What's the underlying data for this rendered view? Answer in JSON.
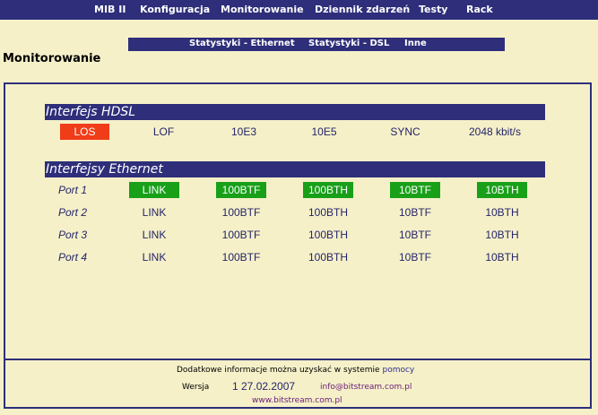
{
  "topnav": [
    "MIB II",
    "Konfiguracja",
    "Monitorowanie",
    "Dziennik zdarzeń",
    "Testy",
    "Rack"
  ],
  "subnav": [
    "Statystyki - Ethernet",
    "Statystyki - DSL",
    "Inne"
  ],
  "page_title": "Monitorowanie",
  "hdsl": {
    "title": "Interfejs HDSL",
    "cells": [
      {
        "text": "LOS",
        "state": "alarm"
      },
      {
        "text": "LOF",
        "state": "off"
      },
      {
        "text": "10E3",
        "state": "off"
      },
      {
        "text": "10E5",
        "state": "off"
      },
      {
        "text": "SYNC",
        "state": "off"
      },
      {
        "text": "2048 kbit/s",
        "state": "off"
      }
    ]
  },
  "ethernet": {
    "title": "Interfejsy Ethernet",
    "ports": [
      {
        "label": "Port 1",
        "cells": [
          {
            "text": "LINK",
            "state": "on"
          },
          {
            "text": "100BTF",
            "state": "on"
          },
          {
            "text": "100BTH",
            "state": "on"
          },
          {
            "text": "10BTF",
            "state": "on"
          },
          {
            "text": "10BTH",
            "state": "on"
          }
        ]
      },
      {
        "label": "Port 2",
        "cells": [
          {
            "text": "LINK",
            "state": "off"
          },
          {
            "text": "100BTF",
            "state": "off"
          },
          {
            "text": "100BTH",
            "state": "off"
          },
          {
            "text": "10BTF",
            "state": "off"
          },
          {
            "text": "10BTH",
            "state": "off"
          }
        ]
      },
      {
        "label": "Port 3",
        "cells": [
          {
            "text": "LINK",
            "state": "off"
          },
          {
            "text": "100BTF",
            "state": "off"
          },
          {
            "text": "100BTH",
            "state": "off"
          },
          {
            "text": "10BTF",
            "state": "off"
          },
          {
            "text": "10BTH",
            "state": "off"
          }
        ]
      },
      {
        "label": "Port 4",
        "cells": [
          {
            "text": "LINK",
            "state": "off"
          },
          {
            "text": "100BTF",
            "state": "off"
          },
          {
            "text": "100BTH",
            "state": "off"
          },
          {
            "text": "10BTF",
            "state": "off"
          },
          {
            "text": "10BTH",
            "state": "off"
          }
        ]
      }
    ]
  },
  "footer": {
    "info_text": "Dodatkowe informacje można uzyskać w systemie",
    "help_link": "pomocy",
    "version_label": "Wersja",
    "version_value": "1 27.02.2007",
    "email": "info@bitstream.com.pl",
    "website": "www.bitstream.com.pl"
  },
  "colors": {
    "nav_bg": "#2e2e7a",
    "page_bg": "#f5f0c8",
    "alarm": "#f03c18",
    "active": "#18a018",
    "text": "#24246a"
  }
}
